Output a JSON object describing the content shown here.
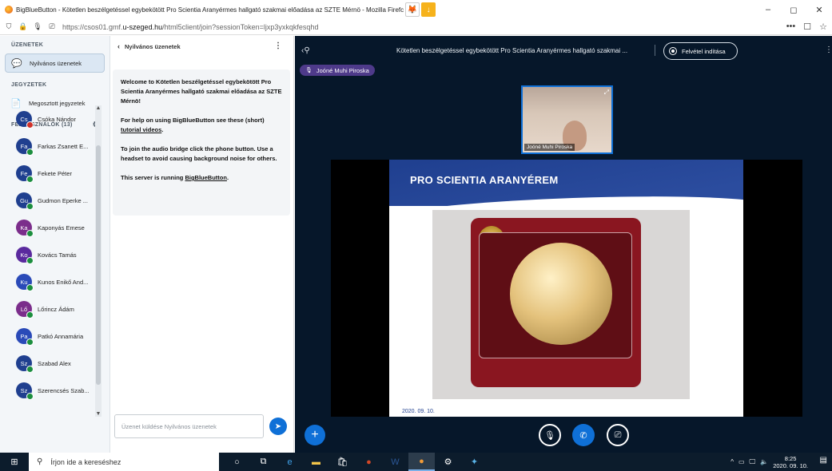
{
  "window": {
    "title": "BigBlueButton - Kötetlen beszélgetéssel egybekötött Pro Scientia Aranyérmes hallgató szakmai előadása az SZTE Mérnö - Mozilla Firefc",
    "controls": [
      "–",
      "◻",
      "✕"
    ]
  },
  "browser": {
    "url_prefix": "https://csos01.gmf.",
    "url_domain": "u-szeged.hu",
    "url_suffix": "/html5client/join?sessionToken=ljxp3yxkqkfesqhd",
    "right_icons": [
      "•••",
      "☐",
      "☆"
    ]
  },
  "sidebar": {
    "messages_header": "ÜZENETEK",
    "public_chat_label": "Nyilvános üzenetek",
    "notes_header": "JEGYZETEK",
    "shared_notes_label": "Megosztott jegyzetek",
    "users_header": "FELHASZNÁLÓK (13)",
    "users": [
      {
        "initials": "Cs",
        "name": "Csóka Nándor",
        "color": "#1f3f8f",
        "status_color": "#d0322a"
      },
      {
        "initials": "Fa",
        "name": "Farkas Zsanett E...",
        "color": "#1f3f8f",
        "status_color": "#1b8e3e"
      },
      {
        "initials": "Fe",
        "name": "Fekete Péter",
        "color": "#1f3f8f",
        "status_color": "#1b8e3e"
      },
      {
        "initials": "Gu",
        "name": "Gudmon Eperke ...",
        "color": "#1f3f8f",
        "status_color": "#1b8e3e"
      },
      {
        "initials": "Ka",
        "name": "Kaponyás Emese",
        "color": "#7b2d8b",
        "status_color": "#1b8e3e"
      },
      {
        "initials": "Ko",
        "name": "Kovács Tamás",
        "color": "#5a2a9e",
        "status_color": "#1b8e3e"
      },
      {
        "initials": "Ku",
        "name": "Kunos Enikő And...",
        "color": "#2a4ab8",
        "status_color": "#1b8e3e"
      },
      {
        "initials": "Lő",
        "name": "Lőrincz Ádám",
        "color": "#7b2d8b",
        "status_color": "#1b8e3e"
      },
      {
        "initials": "Pa",
        "name": "Patkó Annamária",
        "color": "#2a4ab8",
        "status_color": "#1b8e3e"
      },
      {
        "initials": "Sz",
        "name": "Szabad Alex",
        "color": "#1f3f8f",
        "status_color": "#1b8e3e"
      },
      {
        "initials": "Sz",
        "name": "Szerencsés Szab...",
        "color": "#1f3f8f",
        "status_color": "#1b8e3e"
      }
    ]
  },
  "chat": {
    "header": "Nyilvános üzenetek",
    "welcome_line1_prefix": "Welcome to ",
    "welcome_line1_bold": "Kötetlen beszélgetéssel egybekötött Pro Scientia Aranyérmes hallgató szakmai előadása az SZTE Mérnö!",
    "help_prefix": "For help on using BigBlueButton see these (short) ",
    "help_link": "tutorial videos",
    "help_suffix": ".",
    "audio_text": "To join the audio bridge click the phone button. Use a headset to avoid causing background noise for others.",
    "server_prefix": "This server is running ",
    "server_link": "BigBlueButton",
    "server_suffix": ".",
    "input_placeholder": "Üzenet küldése Nyilvános üzenetek"
  },
  "meeting": {
    "title": "Kötetlen beszélgetéssel egybekötött Pro Scientia Aranyérmes hallgató szakmai ...",
    "record_label": "Felvétel indítása",
    "talker": "Joóné Muhi Piroska",
    "webcam_name": "Joóné Muhi Piroska"
  },
  "slide": {
    "title": "PRO SCIENTIA ARANYÉREM",
    "footer": "2020. 09. 10."
  },
  "taskbar": {
    "search_placeholder": "Írjon ide a kereséshez",
    "time": "8:25",
    "date": "2020. 09. 10."
  }
}
